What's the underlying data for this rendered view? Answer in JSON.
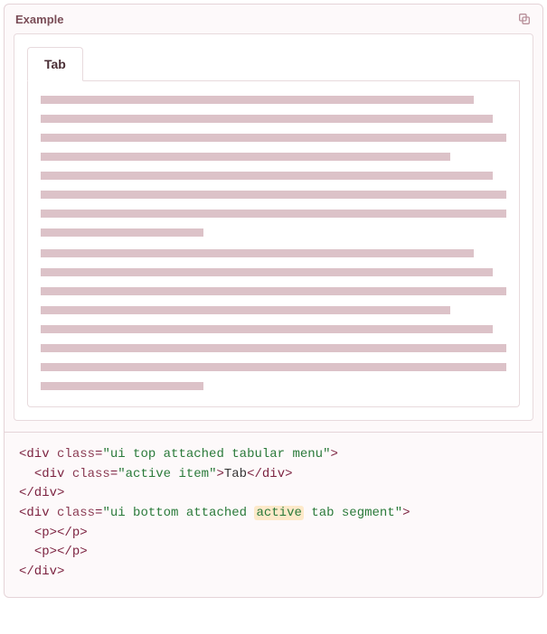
{
  "header": {
    "title": "Example"
  },
  "tab": {
    "label": "Tab"
  },
  "placeholder": {
    "paragraphs": [
      {
        "widths": [
          93,
          97,
          100,
          88,
          97,
          100,
          100,
          35
        ]
      },
      {
        "widths": [
          93,
          97,
          100,
          88,
          97,
          100,
          100,
          35
        ]
      }
    ]
  },
  "code": {
    "lines": [
      {
        "indent": 0,
        "parts": [
          {
            "t": "tag",
            "v": "<div "
          },
          {
            "t": "attr-name",
            "v": "class"
          },
          {
            "t": "tag",
            "v": "="
          },
          {
            "t": "attr-val",
            "v": "\"ui top attached tabular menu\""
          },
          {
            "t": "tag",
            "v": ">"
          }
        ]
      },
      {
        "indent": 1,
        "parts": [
          {
            "t": "tag",
            "v": "<div "
          },
          {
            "t": "attr-name",
            "v": "class"
          },
          {
            "t": "tag",
            "v": "="
          },
          {
            "t": "attr-val",
            "v": "\"active item\""
          },
          {
            "t": "tag",
            "v": ">"
          },
          {
            "t": "txt",
            "v": "Tab"
          },
          {
            "t": "tag",
            "v": "</div>"
          }
        ]
      },
      {
        "indent": 0,
        "parts": [
          {
            "t": "tag",
            "v": "</div>"
          }
        ]
      },
      {
        "indent": 0,
        "parts": [
          {
            "t": "tag",
            "v": "<div "
          },
          {
            "t": "attr-name",
            "v": "class"
          },
          {
            "t": "tag",
            "v": "="
          },
          {
            "t": "attr-val",
            "v": "\"ui bottom attached "
          },
          {
            "t": "highlight",
            "v": "active"
          },
          {
            "t": "attr-val",
            "v": " tab segment\""
          },
          {
            "t": "tag",
            "v": ">"
          }
        ]
      },
      {
        "indent": 1,
        "parts": [
          {
            "t": "tag",
            "v": "<p></p>"
          }
        ]
      },
      {
        "indent": 1,
        "parts": [
          {
            "t": "tag",
            "v": "<p></p>"
          }
        ]
      },
      {
        "indent": 0,
        "parts": [
          {
            "t": "tag",
            "v": "</div>"
          }
        ]
      }
    ]
  }
}
